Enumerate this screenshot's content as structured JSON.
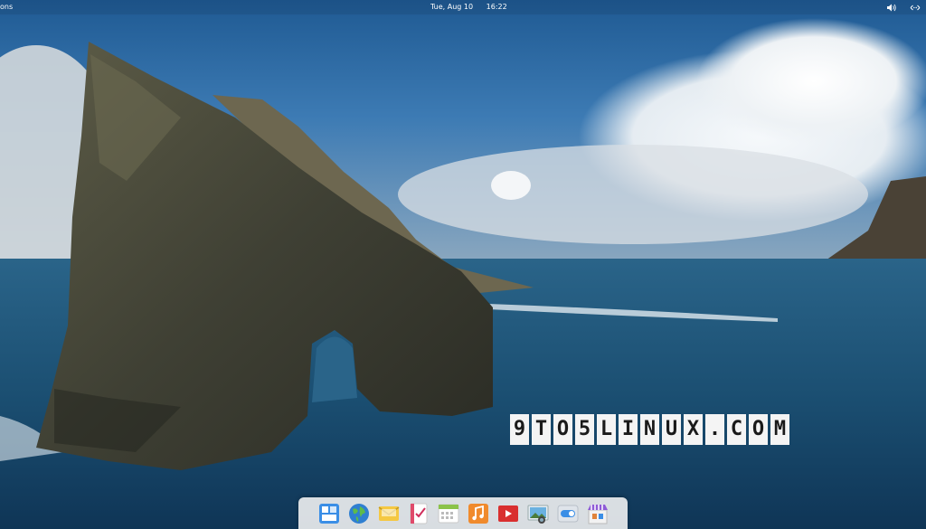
{
  "panel": {
    "applications_label": "ons",
    "date": "Tue, Aug 10",
    "time": "16:22",
    "tray_icons": [
      "volume-icon",
      "network-icon"
    ]
  },
  "watermark": {
    "text": "9TO5LINUX.COM",
    "characters": [
      "9",
      "T",
      "O",
      "5",
      "L",
      "I",
      "N",
      "U",
      "X",
      ".",
      "C",
      "O",
      "M"
    ]
  },
  "dock": {
    "items": [
      {
        "name": "multitasking-view",
        "icon": "multitasking-icon"
      },
      {
        "name": "web-browser",
        "icon": "globe-icon"
      },
      {
        "name": "mail",
        "icon": "mail-icon"
      },
      {
        "name": "tasks",
        "icon": "tasks-icon"
      },
      {
        "name": "calendar",
        "icon": "calendar-icon"
      },
      {
        "name": "music",
        "icon": "music-icon"
      },
      {
        "name": "videos",
        "icon": "video-icon"
      },
      {
        "name": "photos",
        "icon": "photos-icon"
      },
      {
        "name": "system-settings",
        "icon": "settings-icon"
      },
      {
        "name": "appcenter",
        "icon": "store-icon"
      }
    ]
  }
}
